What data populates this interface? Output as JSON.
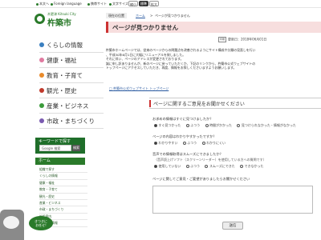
{
  "topbar": {
    "links": [
      "本文へ",
      "Foreign language",
      "携帯サイト",
      "文字サイズ"
    ],
    "size_small": "縮小",
    "size_std": "標準",
    "size_large": "拡大"
  },
  "logo": {
    "small": "木更津 Kitsuki City",
    "big": "杵築市"
  },
  "nav": [
    {
      "label": "くらしの情報",
      "color": "#3a7fc0"
    },
    {
      "label": "健康・福祉",
      "color": "#e07aa0"
    },
    {
      "label": "教育・子育て",
      "color": "#e98a2a"
    },
    {
      "label": "観光・歴史",
      "color": "#c0392b"
    },
    {
      "label": "産業・ビジネス",
      "color": "#3b9b3b"
    },
    {
      "label": "市政・まちづくり",
      "color": "#7a5ab0"
    }
  ],
  "keyword": {
    "title": "キーワードで探す",
    "placeholder": "Google 検索",
    "button": "検索"
  },
  "home": "ホーム",
  "subnav": [
    "組織で探す",
    "くらしの情報",
    "健康・福祉",
    "教育・子育て",
    "観光・歴史",
    "産業・ビジネス",
    "市政・まちづくり",
    "施設案内",
    "イベント情報"
  ],
  "bubble": "きつきに\nお任せ!",
  "breadcrumb": {
    "current_label": "現在の位置",
    "home": "ホーム",
    "page": "ページが見つかりません"
  },
  "page_title": "ページが見つかりません",
  "updated": {
    "icon": "印刷",
    "text": "更新日：2018年06月01日"
  },
  "message": [
    "杵築市ホームページでは、従来のページからの問題点を改善されるようにサイト構成や分類の見直しを行い",
    "、平成30年6月1日に大幅にリニューアルを致しました。",
    "それに伴い、ページのアドレスが変更されております。",
    "誠に申し訳ありませんが、新のページに戻っていただくか、下記のリンクから、杵築市公式ウェブサイトの",
    "トップページにアクセスしていただき、再度、情報をお探しくださいますようお願いします。"
  ],
  "top_link": "杵築市公式ウェブサイト トップページ",
  "feedback": {
    "heading": "ページに関するご意見をお聞かせください",
    "q1": "お求めの情報はすぐに見つけましたか？",
    "q1_options": [
      "すぐ見つかった",
      "ふつう",
      "時間がかかった",
      "見つけられなかった・情報がなかった"
    ],
    "q2": "ページの内容はわかりやすかったですか？",
    "q2_options": [
      "わかりやすい",
      "ふつう",
      "わかりにくい"
    ],
    "q3": "音声での情報取得はスムーズにできましたか？",
    "q3_note": "（音声読上げソフト（スクリーンリーダー）を使用している方への質問です）",
    "q3_options": [
      "使用していない",
      "ふつう",
      "スムーズにできた",
      "できなかった"
    ],
    "q4": "ページに関してご意見・ご要望がありましたらお聞かせください",
    "submit": "送信"
  }
}
